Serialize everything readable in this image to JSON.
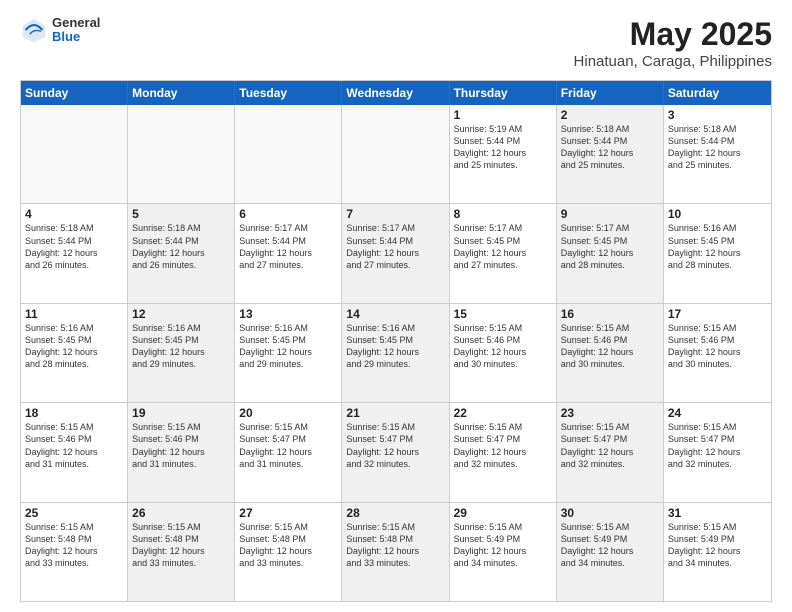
{
  "header": {
    "logo": {
      "general": "General",
      "blue": "Blue"
    },
    "title": "May 2025",
    "subtitle": "Hinatuan, Caraga, Philippines"
  },
  "weekdays": [
    "Sunday",
    "Monday",
    "Tuesday",
    "Wednesday",
    "Thursday",
    "Friday",
    "Saturday"
  ],
  "rows": [
    [
      {
        "day": "",
        "text": "",
        "empty": true
      },
      {
        "day": "",
        "text": "",
        "empty": true
      },
      {
        "day": "",
        "text": "",
        "empty": true
      },
      {
        "day": "",
        "text": "",
        "empty": true
      },
      {
        "day": "1",
        "text": "Sunrise: 5:19 AM\nSunset: 5:44 PM\nDaylight: 12 hours\nand 25 minutes."
      },
      {
        "day": "2",
        "text": "Sunrise: 5:18 AM\nSunset: 5:44 PM\nDaylight: 12 hours\nand 25 minutes.",
        "shaded": true
      },
      {
        "day": "3",
        "text": "Sunrise: 5:18 AM\nSunset: 5:44 PM\nDaylight: 12 hours\nand 25 minutes."
      }
    ],
    [
      {
        "day": "4",
        "text": "Sunrise: 5:18 AM\nSunset: 5:44 PM\nDaylight: 12 hours\nand 26 minutes."
      },
      {
        "day": "5",
        "text": "Sunrise: 5:18 AM\nSunset: 5:44 PM\nDaylight: 12 hours\nand 26 minutes.",
        "shaded": true
      },
      {
        "day": "6",
        "text": "Sunrise: 5:17 AM\nSunset: 5:44 PM\nDaylight: 12 hours\nand 27 minutes."
      },
      {
        "day": "7",
        "text": "Sunrise: 5:17 AM\nSunset: 5:44 PM\nDaylight: 12 hours\nand 27 minutes.",
        "shaded": true
      },
      {
        "day": "8",
        "text": "Sunrise: 5:17 AM\nSunset: 5:45 PM\nDaylight: 12 hours\nand 27 minutes."
      },
      {
        "day": "9",
        "text": "Sunrise: 5:17 AM\nSunset: 5:45 PM\nDaylight: 12 hours\nand 28 minutes.",
        "shaded": true
      },
      {
        "day": "10",
        "text": "Sunrise: 5:16 AM\nSunset: 5:45 PM\nDaylight: 12 hours\nand 28 minutes."
      }
    ],
    [
      {
        "day": "11",
        "text": "Sunrise: 5:16 AM\nSunset: 5:45 PM\nDaylight: 12 hours\nand 28 minutes."
      },
      {
        "day": "12",
        "text": "Sunrise: 5:16 AM\nSunset: 5:45 PM\nDaylight: 12 hours\nand 29 minutes.",
        "shaded": true
      },
      {
        "day": "13",
        "text": "Sunrise: 5:16 AM\nSunset: 5:45 PM\nDaylight: 12 hours\nand 29 minutes."
      },
      {
        "day": "14",
        "text": "Sunrise: 5:16 AM\nSunset: 5:45 PM\nDaylight: 12 hours\nand 29 minutes.",
        "shaded": true
      },
      {
        "day": "15",
        "text": "Sunrise: 5:15 AM\nSunset: 5:46 PM\nDaylight: 12 hours\nand 30 minutes."
      },
      {
        "day": "16",
        "text": "Sunrise: 5:15 AM\nSunset: 5:46 PM\nDaylight: 12 hours\nand 30 minutes.",
        "shaded": true
      },
      {
        "day": "17",
        "text": "Sunrise: 5:15 AM\nSunset: 5:46 PM\nDaylight: 12 hours\nand 30 minutes."
      }
    ],
    [
      {
        "day": "18",
        "text": "Sunrise: 5:15 AM\nSunset: 5:46 PM\nDaylight: 12 hours\nand 31 minutes."
      },
      {
        "day": "19",
        "text": "Sunrise: 5:15 AM\nSunset: 5:46 PM\nDaylight: 12 hours\nand 31 minutes.",
        "shaded": true
      },
      {
        "day": "20",
        "text": "Sunrise: 5:15 AM\nSunset: 5:47 PM\nDaylight: 12 hours\nand 31 minutes."
      },
      {
        "day": "21",
        "text": "Sunrise: 5:15 AM\nSunset: 5:47 PM\nDaylight: 12 hours\nand 32 minutes.",
        "shaded": true
      },
      {
        "day": "22",
        "text": "Sunrise: 5:15 AM\nSunset: 5:47 PM\nDaylight: 12 hours\nand 32 minutes."
      },
      {
        "day": "23",
        "text": "Sunrise: 5:15 AM\nSunset: 5:47 PM\nDaylight: 12 hours\nand 32 minutes.",
        "shaded": true
      },
      {
        "day": "24",
        "text": "Sunrise: 5:15 AM\nSunset: 5:47 PM\nDaylight: 12 hours\nand 32 minutes."
      }
    ],
    [
      {
        "day": "25",
        "text": "Sunrise: 5:15 AM\nSunset: 5:48 PM\nDaylight: 12 hours\nand 33 minutes."
      },
      {
        "day": "26",
        "text": "Sunrise: 5:15 AM\nSunset: 5:48 PM\nDaylight: 12 hours\nand 33 minutes.",
        "shaded": true
      },
      {
        "day": "27",
        "text": "Sunrise: 5:15 AM\nSunset: 5:48 PM\nDaylight: 12 hours\nand 33 minutes."
      },
      {
        "day": "28",
        "text": "Sunrise: 5:15 AM\nSunset: 5:48 PM\nDaylight: 12 hours\nand 33 minutes.",
        "shaded": true
      },
      {
        "day": "29",
        "text": "Sunrise: 5:15 AM\nSunset: 5:49 PM\nDaylight: 12 hours\nand 34 minutes."
      },
      {
        "day": "30",
        "text": "Sunrise: 5:15 AM\nSunset: 5:49 PM\nDaylight: 12 hours\nand 34 minutes.",
        "shaded": true
      },
      {
        "day": "31",
        "text": "Sunrise: 5:15 AM\nSunset: 5:49 PM\nDaylight: 12 hours\nand 34 minutes."
      }
    ]
  ]
}
